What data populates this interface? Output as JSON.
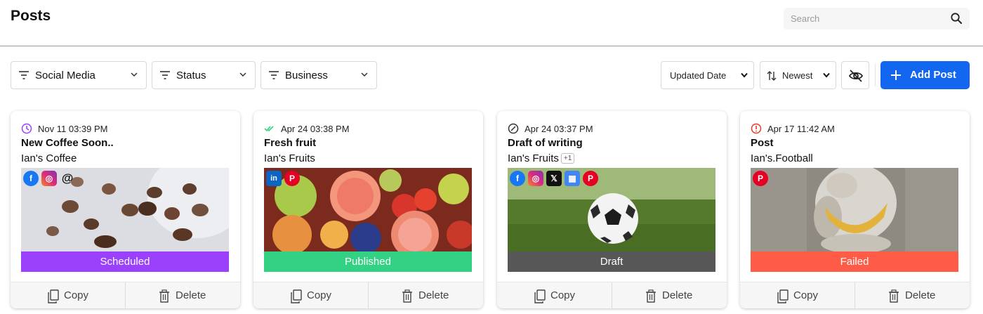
{
  "header": {
    "title": "Posts"
  },
  "search": {
    "placeholder": "Search"
  },
  "filters": {
    "social_media": "Social Media",
    "status": "Status",
    "business": "Business"
  },
  "sort": {
    "field": "Updated Date",
    "order": "Newest"
  },
  "add_post_label": "Add Post",
  "colors": {
    "accent": "#1366f0",
    "scheduled": "#9b40fb",
    "published": "#33d184",
    "draft": "#575757",
    "failed": "#fe5c47"
  },
  "posts": [
    {
      "time": "Nov 11 03:39 PM",
      "title": "New Coffee Soon..",
      "business": "Ian's Coffee",
      "extra_count": "",
      "status": "Scheduled",
      "status_icon": "clock-icon",
      "socials": [
        "facebook-icon",
        "instagram-icon",
        "threads-icon"
      ],
      "copy_label": "Copy",
      "delete_label": "Delete"
    },
    {
      "time": "Apr 24 03:38 PM",
      "title": "Fresh fruit",
      "business": "Ian's Fruits",
      "extra_count": "",
      "status": "Published",
      "status_icon": "double-check-icon",
      "socials": [
        "linkedin-icon",
        "pinterest-icon"
      ],
      "copy_label": "Copy",
      "delete_label": "Delete"
    },
    {
      "time": "Apr 24 03:37 PM",
      "title": "Draft of writing",
      "business": "Ian's Fruits",
      "extra_count": "+1",
      "status": "Draft",
      "status_icon": "compass-icon",
      "socials": [
        "facebook-icon",
        "instagram-icon",
        "x-icon",
        "google-business-icon",
        "pinterest-icon"
      ],
      "copy_label": "Copy",
      "delete_label": "Delete"
    },
    {
      "time": "Apr 17 11:42 AM",
      "title": "Post",
      "business": "Ian's.Football",
      "extra_count": "",
      "status": "Failed",
      "status_icon": "alert-circle-icon",
      "socials": [
        "pinterest-icon"
      ],
      "copy_label": "Copy",
      "delete_label": "Delete"
    }
  ]
}
